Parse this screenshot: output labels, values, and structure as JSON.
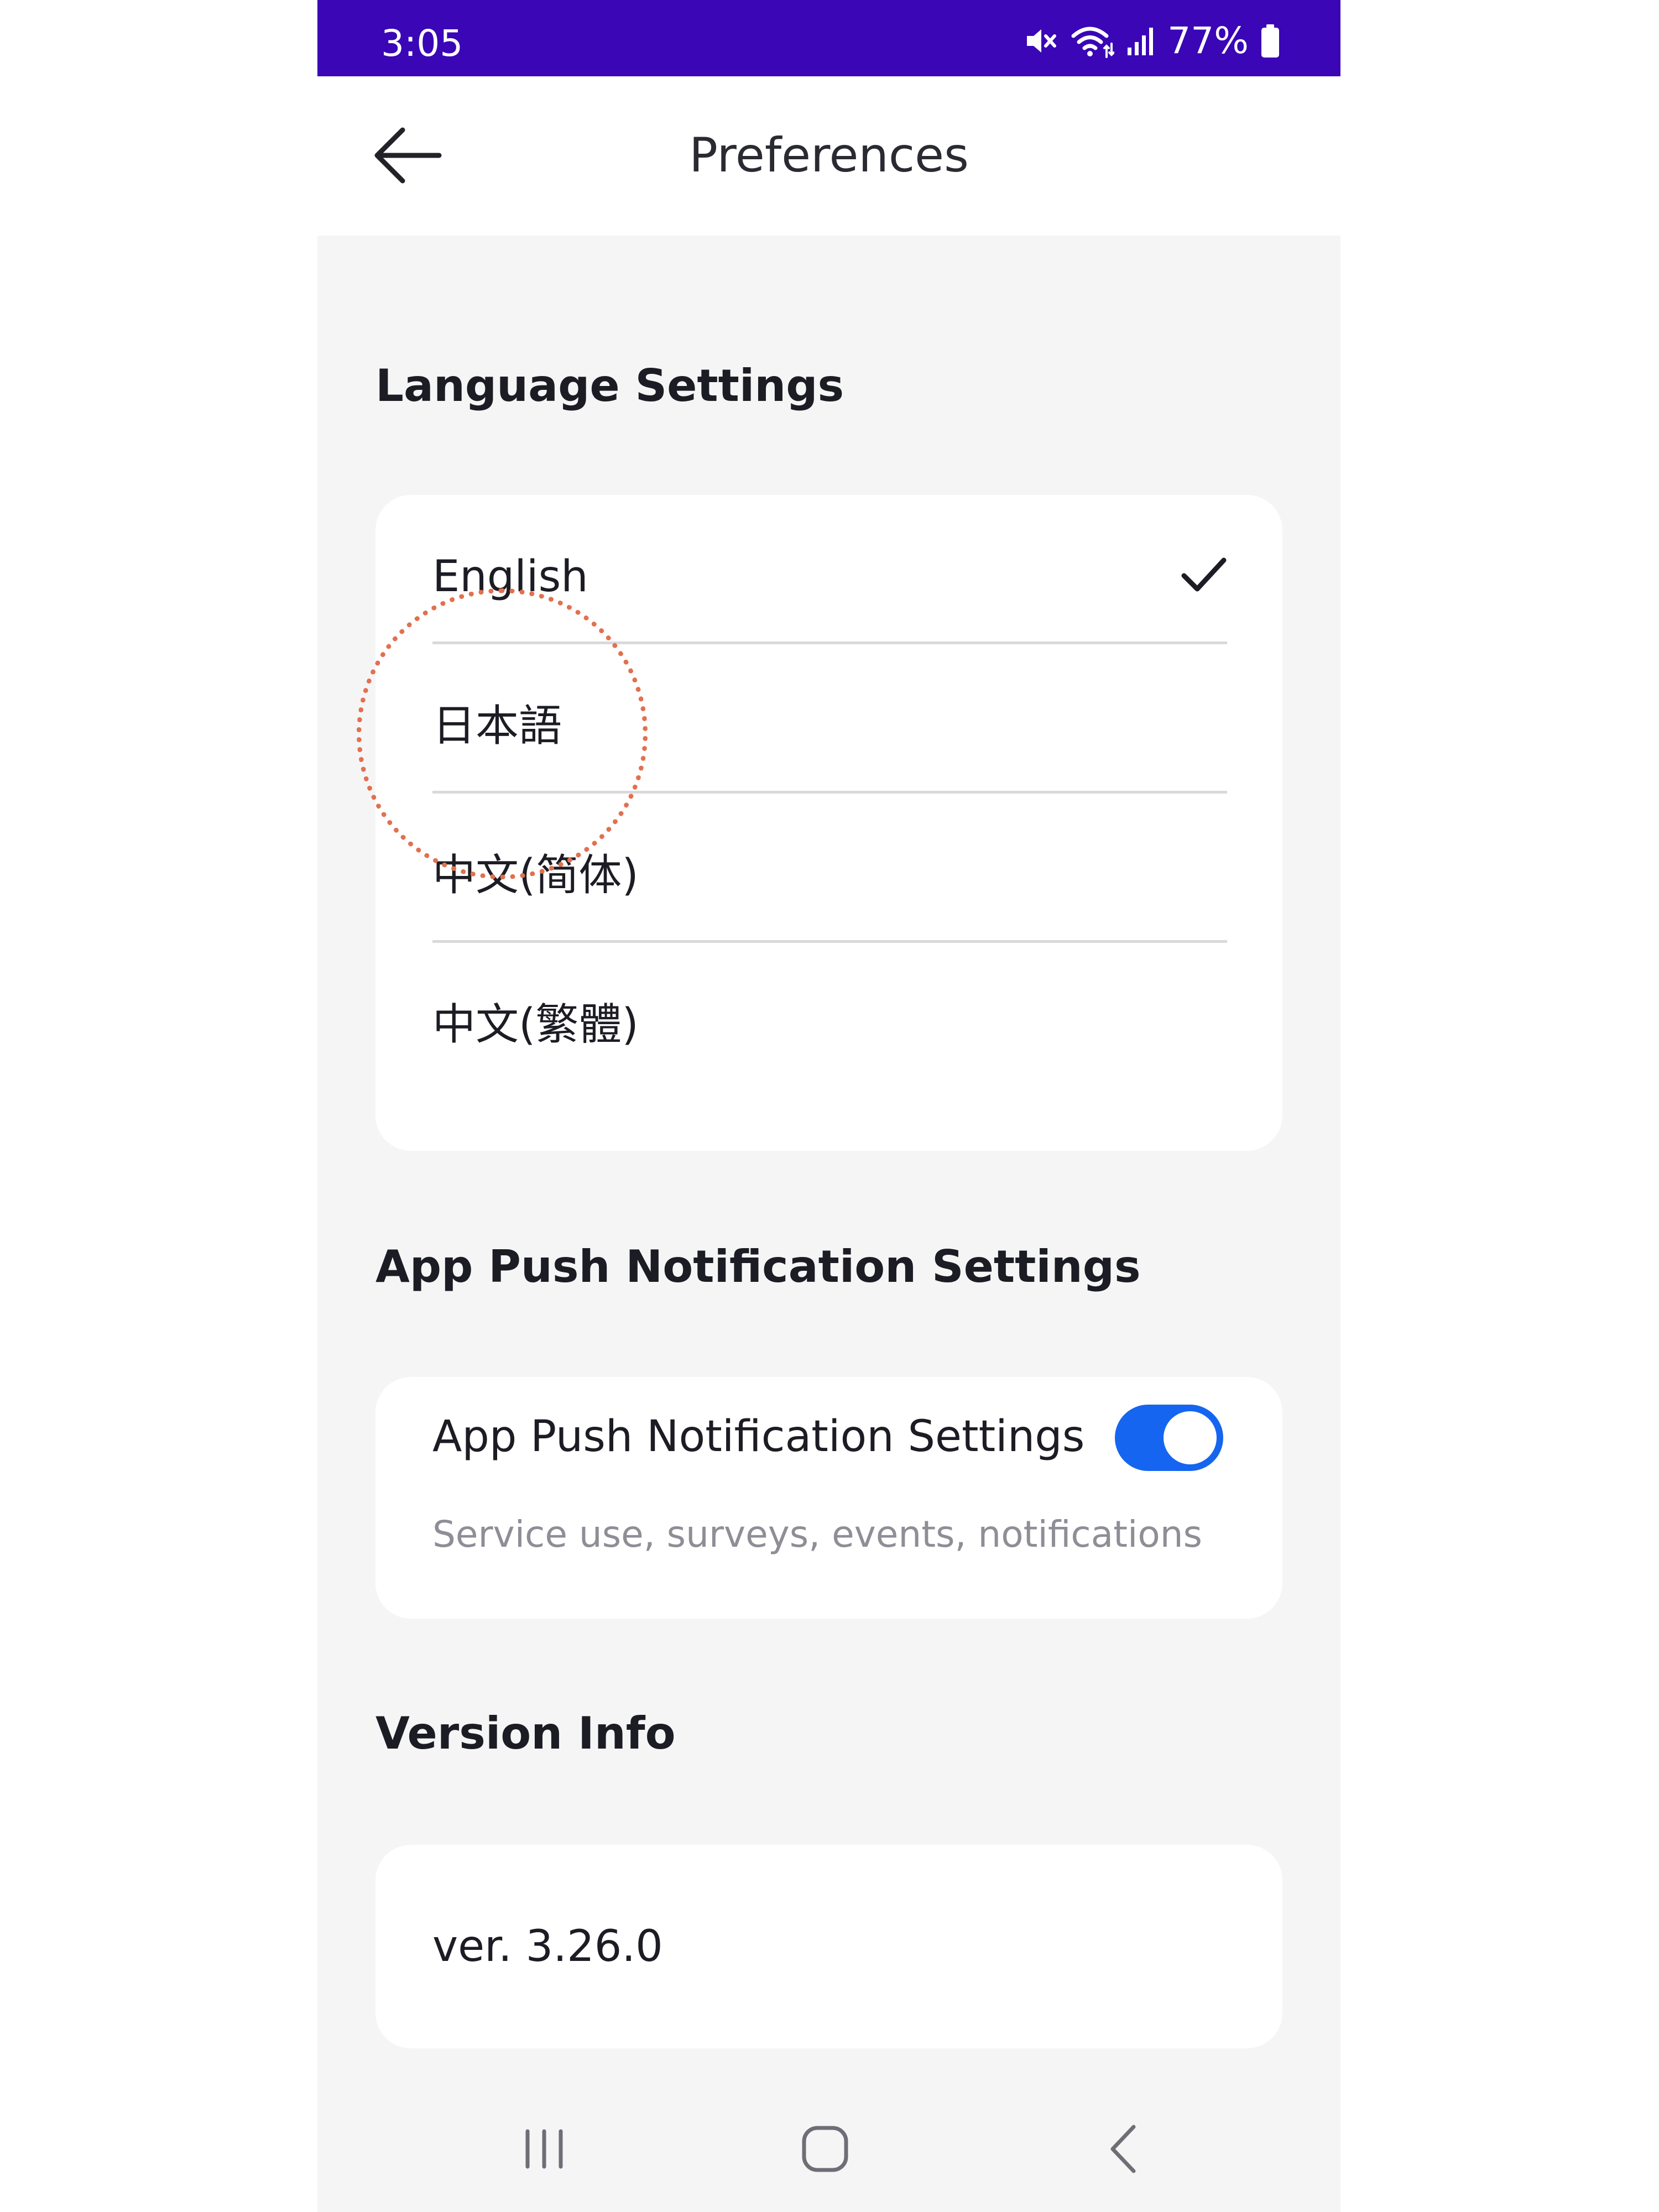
{
  "status_bar": {
    "time": "3:05",
    "battery_percent": "77%",
    "icons": [
      "mute-icon",
      "wifi-icon",
      "signal-icon",
      "battery-icon"
    ]
  },
  "app_bar": {
    "back_icon": "back-arrow-icon",
    "title": "Preferences"
  },
  "language_section": {
    "title": "Language Settings",
    "options": [
      {
        "label": "English",
        "selected": true
      },
      {
        "label": "日本語",
        "selected": false
      },
      {
        "label": "中文(简体)",
        "selected": false
      },
      {
        "label": "中文(繁體)",
        "selected": false
      }
    ],
    "selected_icon": "checkmark-icon"
  },
  "push_section": {
    "title": "App Push Notification Settings",
    "item": {
      "label": "App Push Notification Settings",
      "description": "Service use, surveys, events, notifications",
      "enabled": true
    }
  },
  "version_section": {
    "title": "Version Info",
    "version": "ver. 3.26.0"
  },
  "nav_bar": {
    "icons": [
      "recent-apps-icon",
      "home-icon",
      "back-icon"
    ]
  },
  "colors": {
    "status_bar": "#3a06b6",
    "toggle_on": "#1565f0",
    "background": "#f5f5f6",
    "card": "#ffffff",
    "tap_indicator": "#e2704f"
  }
}
